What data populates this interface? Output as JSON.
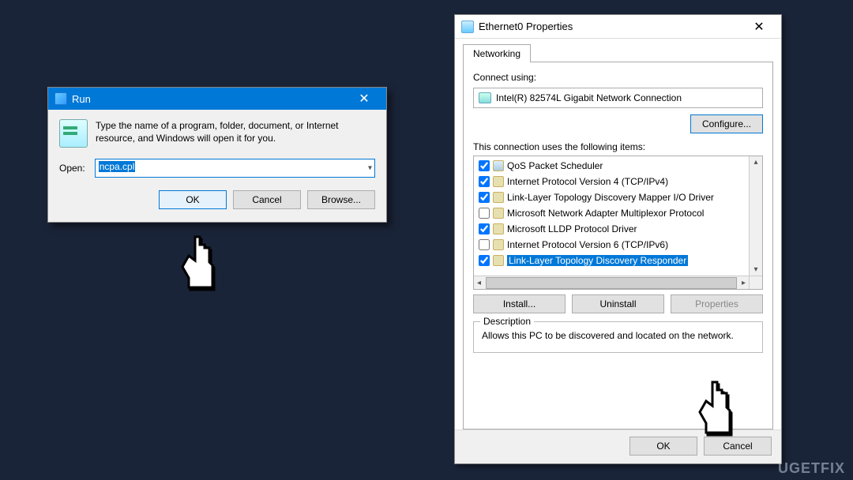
{
  "run": {
    "title": "Run",
    "help_text": "Type the name of a program, folder, document, or Internet resource, and Windows will open it for you.",
    "open_label": "Open:",
    "input_value": "ncpa.cpl",
    "ok": "OK",
    "cancel": "Cancel",
    "browse": "Browse..."
  },
  "props": {
    "title": "Ethernet0 Properties",
    "tab": "Networking",
    "connect_using": "Connect using:",
    "adapter": "Intel(R) 82574L Gigabit Network Connection",
    "configure": "Configure...",
    "items_label": "This connection uses the following items:",
    "items": [
      {
        "checked": true,
        "icon": "qos",
        "label": "QoS Packet Scheduler"
      },
      {
        "checked": true,
        "icon": "std",
        "label": "Internet Protocol Version 4 (TCP/IPv4)"
      },
      {
        "checked": true,
        "icon": "std",
        "label": "Link-Layer Topology Discovery Mapper I/O Driver"
      },
      {
        "checked": false,
        "icon": "std",
        "label": "Microsoft Network Adapter Multiplexor Protocol"
      },
      {
        "checked": true,
        "icon": "std",
        "label": "Microsoft LLDP Protocol Driver"
      },
      {
        "checked": false,
        "icon": "std",
        "label": "Internet Protocol Version 6 (TCP/IPv6)"
      },
      {
        "checked": true,
        "icon": "std",
        "label": "Link-Layer Topology Discovery Responder",
        "selected": true
      }
    ],
    "install": "Install...",
    "uninstall": "Uninstall",
    "properties": "Properties",
    "group": "Description",
    "description": "Allows this PC to be discovered and located on the network.",
    "ok": "OK",
    "cancel": "Cancel"
  },
  "watermark": "UGETFIX"
}
